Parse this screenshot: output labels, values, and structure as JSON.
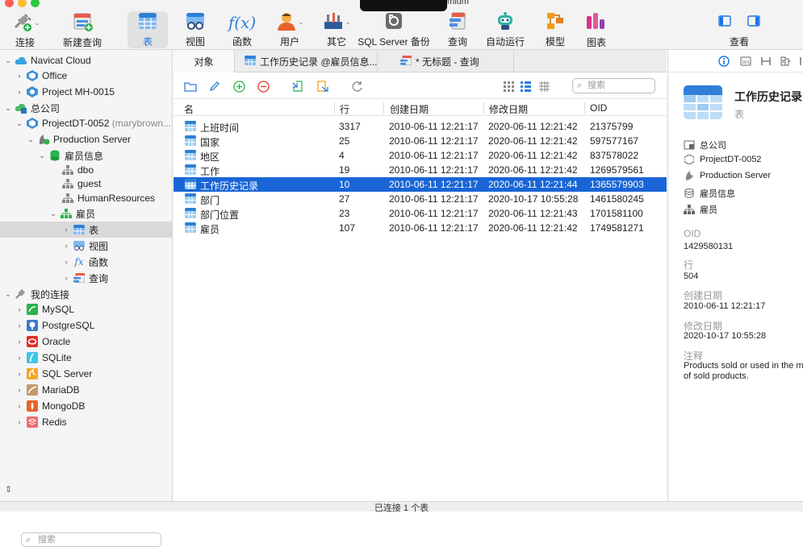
{
  "window": {
    "title_fragment": "mium"
  },
  "toolbar": {
    "connect": "连接",
    "new_query": "新建查询",
    "table": "表",
    "view": "视图",
    "function": "函数",
    "user": "用户",
    "other": "其它",
    "sqlserver_backup": "SQL Server 备份",
    "query": "查询",
    "automation": "自动运行",
    "model": "模型",
    "chart": "图表",
    "viewmode": "查看"
  },
  "sidebar": {
    "items": [
      {
        "label": "Navicat Cloud"
      },
      {
        "label": "Office"
      },
      {
        "label": "Project MH-0015"
      },
      {
        "label": "总公司"
      },
      {
        "label": "ProjectDT-0052",
        "muted": "(marybrown..."
      },
      {
        "label": "Production Server"
      },
      {
        "label": "雇员信息"
      },
      {
        "label": "dbo"
      },
      {
        "label": "guest"
      },
      {
        "label": "HumanResources"
      },
      {
        "label": "雇员"
      },
      {
        "label": "表"
      },
      {
        "label": "视图"
      },
      {
        "label": "函数"
      },
      {
        "label": "查询"
      },
      {
        "label": "我的连接"
      },
      {
        "label": "MySQL"
      },
      {
        "label": "PostgreSQL"
      },
      {
        "label": "Oracle"
      },
      {
        "label": "SQLite"
      },
      {
        "label": "SQL Server"
      },
      {
        "label": "MariaDB"
      },
      {
        "label": "MongoDB"
      },
      {
        "label": "Redis"
      }
    ],
    "search_placeholder": "搜索"
  },
  "tabs": [
    {
      "label": "对象"
    },
    {
      "label": "工作历史记录 @雇员信息..."
    },
    {
      "label": "* 无标题 - 查询"
    }
  ],
  "objects": {
    "search_placeholder": "搜索",
    "columns": [
      "名",
      "行",
      "创建日期",
      "修改日期",
      "OID"
    ],
    "rows": [
      {
        "name": "上班时间",
        "rows": "3317",
        "created": "2010-06-11 12:21:17",
        "modified": "2020-06-11 12:21:42",
        "oid": "21375799"
      },
      {
        "name": "国家",
        "rows": "25",
        "created": "2010-06-11 12:21:17",
        "modified": "2020-06-11 12:21:42",
        "oid": "597577167"
      },
      {
        "name": "地区",
        "rows": "4",
        "created": "2010-06-11 12:21:17",
        "modified": "2020-06-11 12:21:42",
        "oid": "837578022"
      },
      {
        "name": "工作",
        "rows": "19",
        "created": "2010-06-11 12:21:17",
        "modified": "2020-06-11 12:21:42",
        "oid": "1269579561"
      },
      {
        "name": "工作历史记录",
        "rows": "10",
        "created": "2010-06-11 12:21:17",
        "modified": "2020-06-11 12:21:44",
        "oid": "1365579903"
      },
      {
        "name": "部门",
        "rows": "27",
        "created": "2010-06-11 12:21:17",
        "modified": "2020-10-17 10:55:28",
        "oid": "1461580245"
      },
      {
        "name": "部门位置",
        "rows": "23",
        "created": "2010-06-11 12:21:17",
        "modified": "2020-06-11 12:21:43",
        "oid": "1701581100"
      },
      {
        "name": "雇员",
        "rows": "107",
        "created": "2010-06-11 12:21:17",
        "modified": "2020-06-11 12:21:42",
        "oid": "1749581271"
      }
    ],
    "selected_index": 4
  },
  "info": {
    "title": "工作历史记录",
    "subtitle": "表",
    "crumbs": [
      "总公司",
      "ProjectDT-0052",
      "Production Server",
      "雇员信息",
      "雇员"
    ],
    "oid_label": "OID",
    "oid": "1429580131",
    "rows_label": "行",
    "rows": "504",
    "created_label": "创建日期",
    "created": "2010-06-11 12:21:17",
    "modified_label": "修改日期",
    "modified": "2020-10-17 10:55:28",
    "comment_label": "注释",
    "comment_line1": "Products sold or used in the mant",
    "comment_line2": "of sold products."
  },
  "status": {
    "text": "已连接 1 个表"
  },
  "colors": {
    "accent": "#1a73e8",
    "selection": "#1965d6",
    "table_icon": "#4a90e2"
  }
}
